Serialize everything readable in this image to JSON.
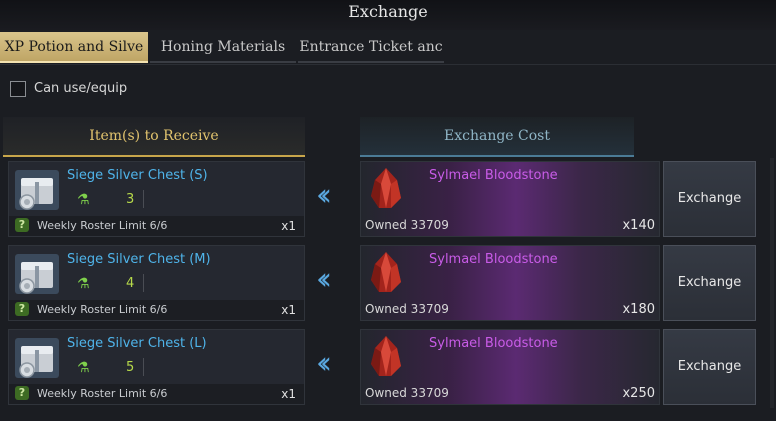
{
  "window": {
    "title": "Exchange"
  },
  "tabs": [
    {
      "label": "XP Potion and Silve",
      "active": true
    },
    {
      "label": "Honing Materials",
      "active": false
    },
    {
      "label": "Entrance Ticket anc",
      "active": false
    }
  ],
  "filter": {
    "can_use_label": "Can use/equip",
    "checked": false
  },
  "headers": {
    "receive": "Item(s) to Receive",
    "cost": "Exchange Cost"
  },
  "rows": [
    {
      "receive": {
        "name": "Siege Silver Chest (S)",
        "level": "3",
        "limit": "Weekly Roster Limit 6/6",
        "qty": "x1",
        "icon": "silver-chest-icon"
      },
      "cost": {
        "name": "Sylmael Bloodstone",
        "owned": "Owned 33709",
        "qty": "x140",
        "icon": "bloodstone-icon"
      },
      "button": "Exchange"
    },
    {
      "receive": {
        "name": "Siege Silver Chest (M)",
        "level": "4",
        "limit": "Weekly Roster Limit 6/6",
        "qty": "x1",
        "icon": "silver-chest-icon"
      },
      "cost": {
        "name": "Sylmael Bloodstone",
        "owned": "Owned 33709",
        "qty": "x180",
        "icon": "bloodstone-icon"
      },
      "button": "Exchange"
    },
    {
      "receive": {
        "name": "Siege Silver Chest (L)",
        "level": "5",
        "limit": "Weekly Roster Limit 6/6",
        "qty": "x1",
        "icon": "silver-chest-icon"
      },
      "cost": {
        "name": "Sylmael Bloodstone",
        "owned": "Owned 33709",
        "qty": "x250",
        "icon": "bloodstone-icon"
      },
      "button": "Exchange"
    }
  ],
  "colors": {
    "accent_gold": "#e2c46e",
    "accent_blue": "#4fb4ea",
    "material_purple": "#c95ce8",
    "level_green": "#b6d94a"
  }
}
